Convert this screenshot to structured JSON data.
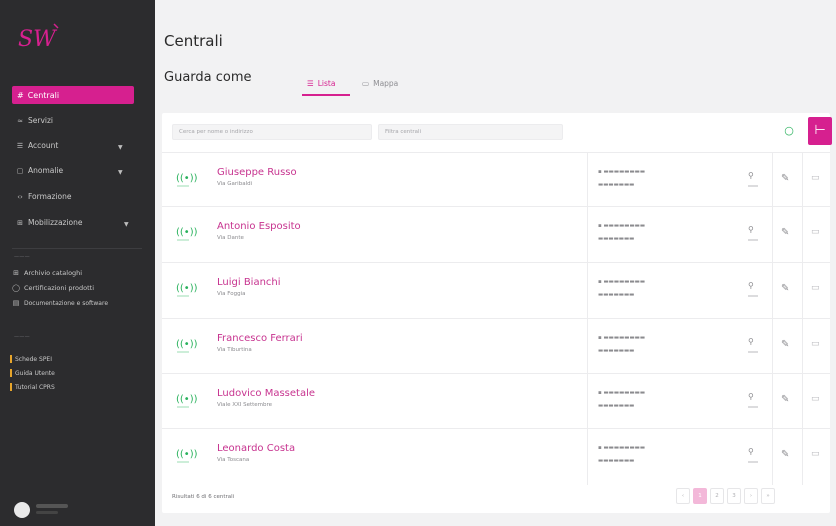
{
  "brand": {
    "accent": "#d6208f",
    "sidebar_bg": "#2c2c2e",
    "signal_green": "#29b15c"
  },
  "sidebar": {
    "logo_text": "SW",
    "active_item": {
      "label": "Centrali",
      "icon": "hash-icon"
    },
    "items": [
      {
        "label": "Servizi",
        "icon": "wave-icon",
        "has_caret": false
      },
      {
        "label": "Account",
        "icon": "list-icon",
        "has_caret": true
      },
      {
        "label": "Anomalie",
        "icon": "box-icon",
        "has_caret": true
      },
      {
        "label": "Formazione",
        "icon": "arrow-icon",
        "has_caret": false
      },
      {
        "label": "Mobilizzazione",
        "icon": "grid-icon",
        "has_caret": true
      }
    ],
    "group2_items": [
      {
        "label": "Archivio cataloghi",
        "icon": "grid-icon"
      },
      {
        "label": "Certificazioni prodotti",
        "icon": "doc-icon"
      },
      {
        "label": "Documentazione e software",
        "icon": "doc-icon"
      }
    ],
    "group3_items": [
      {
        "label": "Schede SPEI"
      },
      {
        "label": "Guida Utente"
      },
      {
        "label": "Tutorial CPRS"
      }
    ]
  },
  "header": {
    "title": "Centrali",
    "view_label": "Guarda come",
    "tab_list": "Lista",
    "tab_map": "Mappa"
  },
  "toolbar": {
    "search_placeholder": "Cerca per nome o indirizzo",
    "filter_placeholder": "Filtra centrali"
  },
  "rows": [
    {
      "name": "Giuseppe Russo",
      "address": "Via Garibaldi"
    },
    {
      "name": "Antonio Esposito",
      "address": "Via Dante"
    },
    {
      "name": "Luigi Bianchi",
      "address": "Via Foggia"
    },
    {
      "name": "Francesco Ferrari",
      "address": "Via Tiburtina"
    },
    {
      "name": "Ludovico Massetale",
      "address": "Viale XXI Settembre"
    },
    {
      "name": "Leonardo Costa",
      "address": "Via Toscana"
    }
  ],
  "footer": {
    "results_text": "Risultati 6 di 6 centrali",
    "pages": [
      "‹",
      "1",
      "2",
      "3",
      "›",
      "»"
    ]
  }
}
